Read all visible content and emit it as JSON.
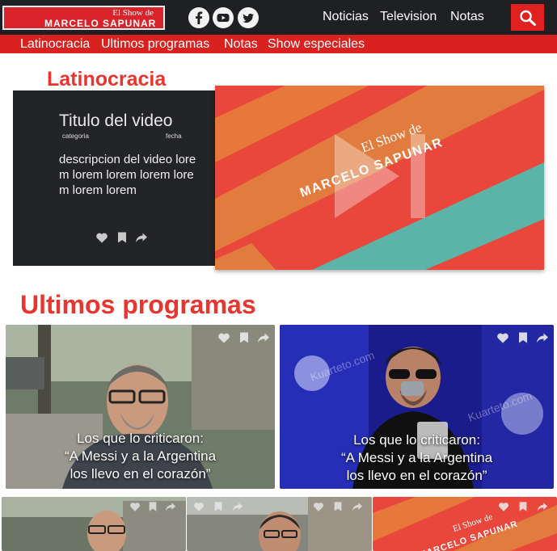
{
  "header": {
    "logo_line1": "El Show de",
    "logo_line2": "MARCELO SAPUNAR",
    "social": [
      "facebook-icon",
      "youtube-icon",
      "twitter-icon"
    ],
    "nav": [
      "Noticias",
      "Television",
      "Notas"
    ],
    "search_icon": "search-icon"
  },
  "subnav": [
    "Latinocracia",
    "Ultimos programas",
    "Notas",
    "Show especiales"
  ],
  "featured": {
    "section_title": "Latinocracia",
    "video_title": "Titulo del video",
    "category": "categoria",
    "date": "fecha",
    "description": "descripcion del video lorem lorem lorem lorem lorem lorem lorem",
    "image_logo_line1": "El Show de",
    "image_logo_line2": "MARCELO SAPUNAR",
    "actions": [
      "heart-icon",
      "bookmark-icon",
      "share-icon"
    ]
  },
  "programs": {
    "section_title": "Ultimos programas",
    "cards": [
      {
        "caption_line1": "Los que lo criticaron:",
        "caption_line2": "“A Messi y a la Argentina",
        "caption_line3": "los llevo en el corazón”"
      },
      {
        "caption_line1": "Los que lo criticaron:",
        "caption_line2": "“A Messi y a la Argentina",
        "caption_line3": "los llevo en el corazón”",
        "watermark": "Kuarteto.com"
      }
    ],
    "small_cards_logo_line1": "El Show de",
    "small_cards_logo_line2": "MARCELO SAPUNAR"
  },
  "colors": {
    "brand_red": "#d9211f",
    "title_red": "#e8352f",
    "dark": "#1f2023"
  }
}
